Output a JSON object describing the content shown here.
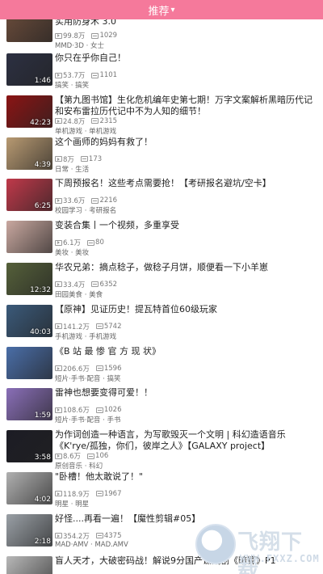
{
  "header": {
    "title": "推荐",
    "chevron_icon": "chevron-down-icon",
    "color": "#f5799b"
  },
  "feed": [
    {
      "title": "实用防身术 3.0",
      "plays": "99.8万",
      "danmu": "1029",
      "category": "MMD·3D · 女士",
      "duration": "",
      "thumb_color": "#6b4c3b"
    },
    {
      "title": "你只在乎你自己！",
      "plays": "53.7万",
      "danmu": "1101",
      "category": "搞笑 · 搞笑",
      "duration": "1:46",
      "thumb_color": "#2c3042"
    },
    {
      "title": "【第九图书馆】生化危机编年史第七期！万字文案解析黑暗历代记和安布雷拉历代记中不为人知的细节！",
      "plays": "24.8万",
      "danmu": "2315",
      "category": "单机游戏 · 单机游戏",
      "duration": "42:23",
      "thumb_color": "#8b1414"
    },
    {
      "title": "这个画师的妈妈有救了！",
      "plays": "8万",
      "danmu": "173",
      "category": "日常 · 生活",
      "duration": "4:39",
      "thumb_color": "#b89a72"
    },
    {
      "title": "下周预报名！这些考点需要抢！【考研报名避坑/空卡】",
      "plays": "33.6万",
      "danmu": "2216",
      "category": "校园学习 · 考研报名",
      "duration": "6:25",
      "thumb_color": "#c0394a"
    },
    {
      "title": "变装合集丨一个视频，多重享受",
      "plays": "6.1万",
      "danmu": "80",
      "category": "美妆 · 美妆",
      "duration": "",
      "thumb_color": "#c9a8a0"
    },
    {
      "title": "华农兄弟：摘点稔子，做稔子月饼，顺便看一下小羊崽",
      "plays": "33.4万",
      "danmu": "6352",
      "category": "田园美食 · 美食",
      "duration": "12:32",
      "thumb_color": "#55603a"
    },
    {
      "title": "【原神】见证历史！提瓦特首位60级玩家",
      "plays": "141.2万",
      "danmu": "5742",
      "category": "手机游戏 · 手机游戏",
      "duration": "40:03",
      "thumb_color": "#3b5a7a"
    },
    {
      "title": "《B 站 最 惨 官 方 现 状》",
      "plays": "206.6万",
      "danmu": "1596",
      "category": "短片·手书·配音 · 搞笑",
      "duration": "",
      "thumb_color": "#4a6ea8"
    },
    {
      "title": "雷神也想要变得可爱！！",
      "plays": "108.6万",
      "danmu": "1026",
      "category": "短片·手书·配音 · 手书",
      "duration": "1:59",
      "thumb_color": "#8a6fb8"
    },
    {
      "title": "为作词创造一种语言，为写歌毁灭一个文明 | 科幻造语音乐《K'rye/孤独，你们，彼岸之人》【GALAXY project】",
      "plays": "8.6万",
      "danmu": "106",
      "category": "原创音乐 · 科幻",
      "duration": "3:58",
      "thumb_color": "#1c1c24"
    },
    {
      "title": "\"卧槽！他太敢说了！\"",
      "plays": "118.9万",
      "danmu": "1967",
      "category": "明星 · 明星",
      "duration": "4:02",
      "thumb_color": "#b0b0b0"
    },
    {
      "title": "好怪....再看一遍！【魔性剪辑#05】",
      "plays": "354.2万",
      "danmu": "4375",
      "category": "MAD·AMV · MAD.AMV",
      "duration": "2:18",
      "thumb_color": "#9aa0a6"
    },
    {
      "title": "盲人天才，大破密码战！解说9分国产谍战剧《暗算》P1",
      "plays": "",
      "danmu": "",
      "category": "",
      "duration": "",
      "thumb_color": "#b8b8b8"
    }
  ],
  "watermark": {
    "text": "飞翔下载",
    "url_text": "WWW.FXXZ.COM"
  }
}
